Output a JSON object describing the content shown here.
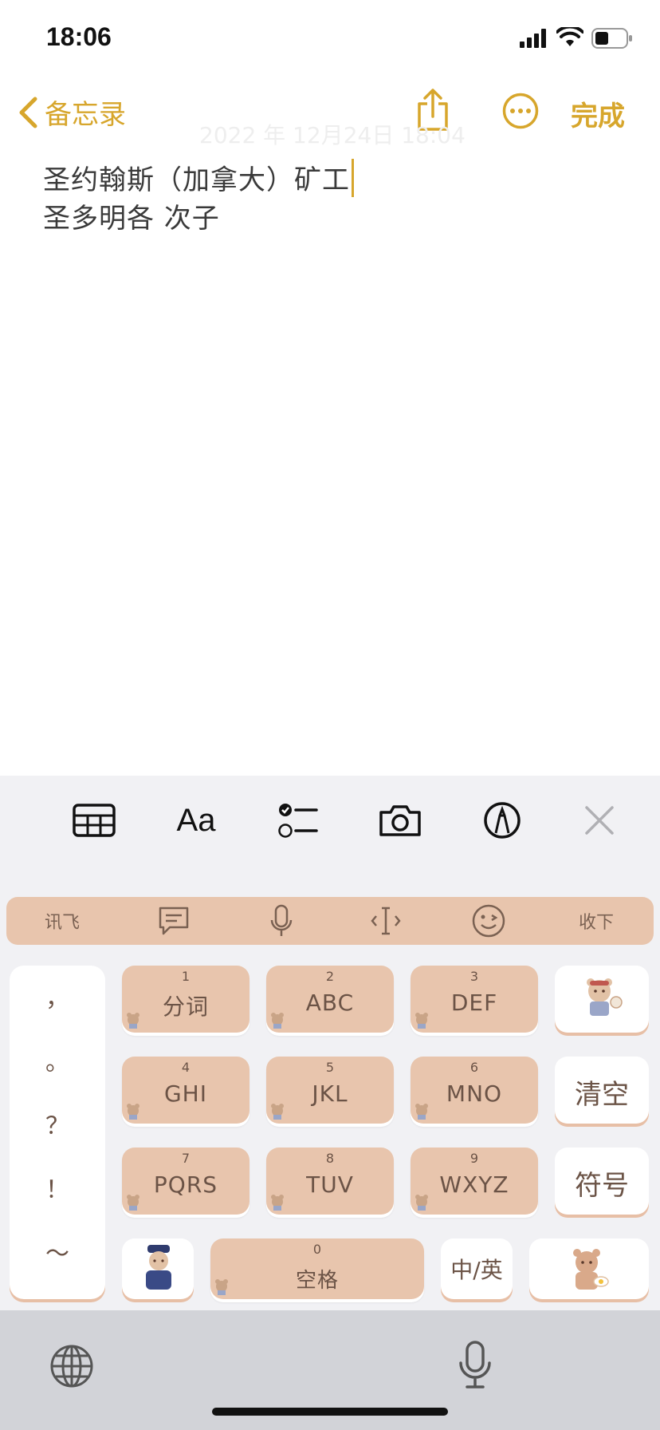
{
  "status_bar": {
    "time": "18:06"
  },
  "nav": {
    "back_label": "备忘录",
    "done_label": "完成"
  },
  "note": {
    "faded_date": "2022 年 12月24日 18:04",
    "lines": [
      "圣约翰斯（加拿大）矿工",
      "圣多明各 次子"
    ]
  },
  "toolbar": {
    "items": [
      "table-icon",
      "text-format-icon",
      "checklist-icon",
      "camera-icon",
      "markup-icon",
      "close-icon"
    ],
    "format_label": "Aa"
  },
  "candidate_bar": {
    "brand": "讯飞",
    "collapse": "收下"
  },
  "keyboard": {
    "punctuation": [
      "，",
      "。",
      "？",
      "！",
      "～"
    ],
    "keys": [
      {
        "num": "1",
        "label": "分词"
      },
      {
        "num": "2",
        "label": "ABC"
      },
      {
        "num": "3",
        "label": "DEF"
      },
      {
        "num": "4",
        "label": "GHI"
      },
      {
        "num": "5",
        "label": "JKL"
      },
      {
        "num": "6",
        "label": "MNO"
      },
      {
        "num": "7",
        "label": "PQRS"
      },
      {
        "num": "8",
        "label": "TUV"
      },
      {
        "num": "9",
        "label": "WXYZ"
      }
    ],
    "clear_label": "清空",
    "symbol_label": "符号",
    "space_num": "0",
    "space_label": "空格",
    "lang_label": "中/英"
  },
  "colors": {
    "accent": "#d7a62c",
    "key": "#e8c5ad",
    "key_text": "#6b5346"
  }
}
